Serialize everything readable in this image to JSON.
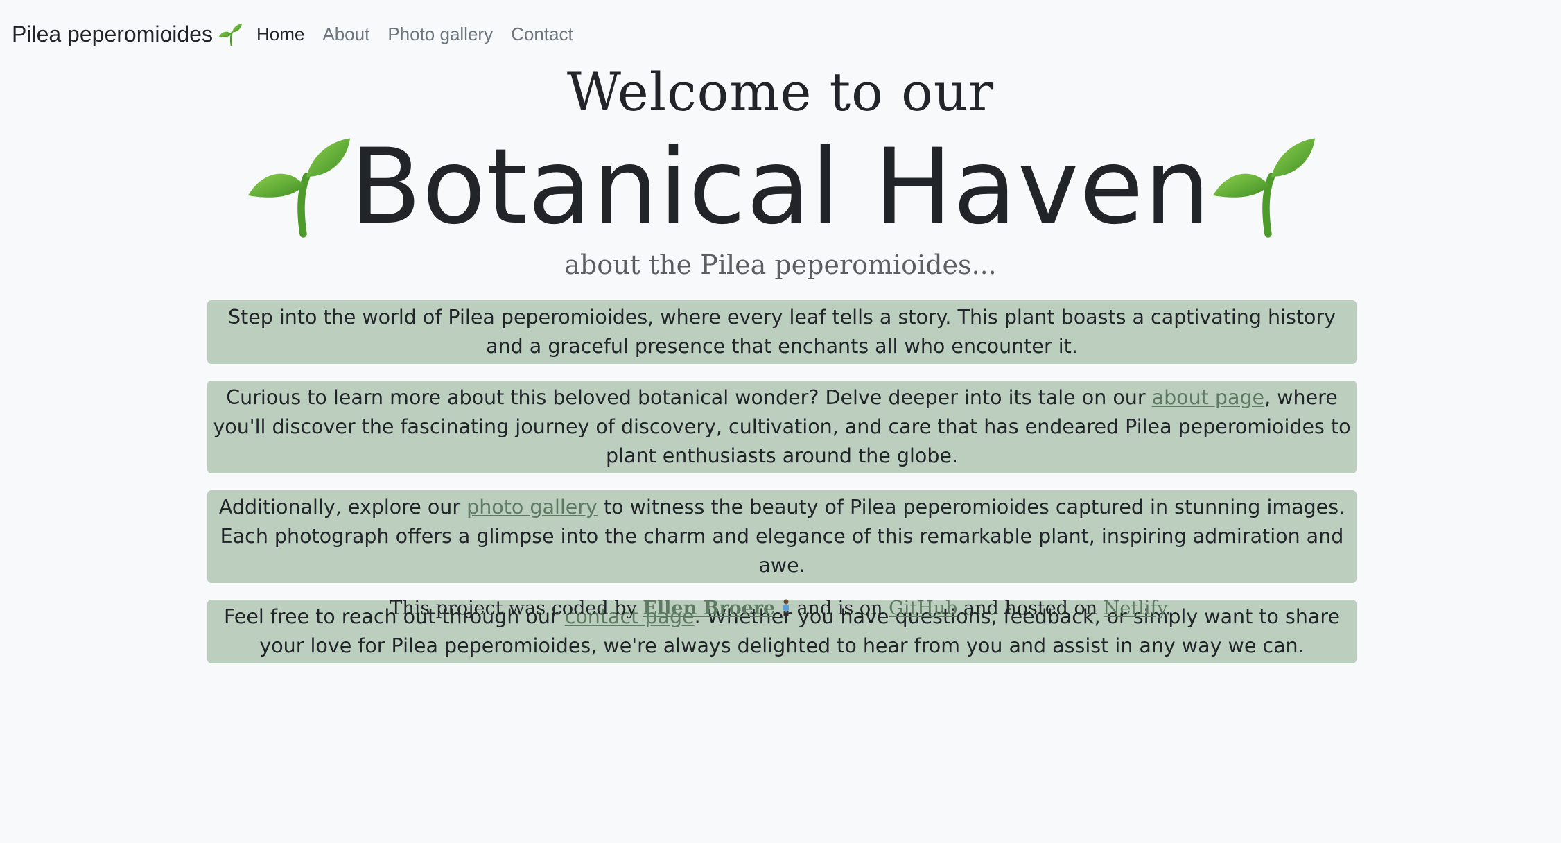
{
  "nav": {
    "brand": "Pilea peperomioides",
    "brand_icon": "sprout-icon",
    "links": [
      {
        "label": "Home",
        "active": true
      },
      {
        "label": "About",
        "active": false
      },
      {
        "label": "Photo gallery",
        "active": false
      },
      {
        "label": "Contact",
        "active": false
      }
    ]
  },
  "hero": {
    "welcome": "Welcome to our",
    "title": "Botanical Haven",
    "subtitle": "about the Pilea peperomioides..."
  },
  "paragraphs": {
    "p1": "Step into the world of Pilea peperomioides, where every leaf tells a story. This plant boasts a captivating history and a graceful presence that enchants all who encounter it.",
    "p2_before": "Curious to learn more about this beloved botanical wonder? Delve deeper into its tale on our ",
    "p2_link": "about page",
    "p2_after": ", where you'll discover the fascinating journey of discovery, cultivation, and care that has endeared Pilea peperomioides to plant enthusiasts around the globe.",
    "p3_before": "Additionally, explore our ",
    "p3_link": "photo gallery",
    "p3_after": " to witness the beauty of Pilea peperomioides captured in stunning images. Each photograph offers a glimpse into the charm and elegance of this remarkable plant, inspiring admiration and awe.",
    "p4_before": "Feel free to reach out through our ",
    "p4_link": "contact page",
    "p4_after": ". Whether you have questions, feedback, or simply want to share your love for Pilea peperomioides, we're always delighted to hear from you and assist in any way we can."
  },
  "footer": {
    "before": "This project was coded by ",
    "author": "Ellen Broere",
    "mid1": " and is on ",
    "github": "GitHub",
    "mid2": " and hosted on ",
    "netlify": "Netlify",
    "end": "."
  },
  "colors": {
    "background": "#f8f9fa",
    "box": "#bccfbf",
    "link": "#5e7a62",
    "leaf": "#5cae3a"
  }
}
